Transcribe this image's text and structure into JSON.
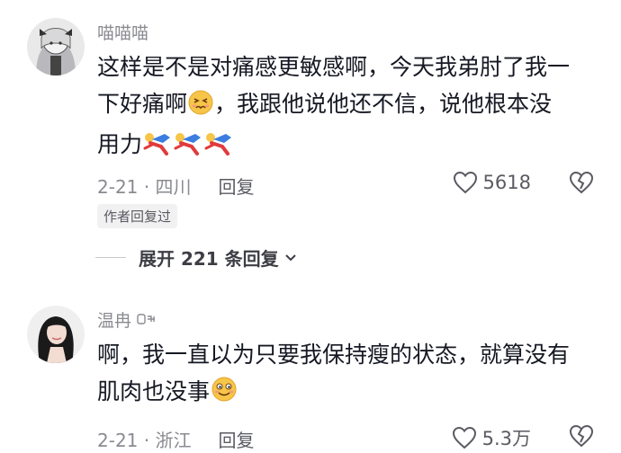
{
  "comments": [
    {
      "username": "喵喵喵",
      "lines": [
        "这样是不是对痛感更敏感啊，今天我弟肘了我一",
        "下好痛啊",
        "，我跟他说他还不信，说他根本没",
        "用力"
      ],
      "emoji_after_line2": "persevering-face",
      "trailing_emoji": [
        "kick-sticker",
        "kick-sticker",
        "kick-sticker"
      ],
      "date_location": "2-21 · 四川",
      "reply_label": "回复",
      "like_count": "5618",
      "author_tag": "作者回复过",
      "expand_label": "展开 221 条回复"
    },
    {
      "username": "温冉",
      "lines": [
        "啊，我一直以为只要我保持瘦的状态，就算没有",
        "肌肉也没事"
      ],
      "trailing_emoji": [
        "slightly-smiling-face"
      ],
      "date_location": "2-21 · 浙江",
      "reply_label": "回复",
      "like_count": "5.3万"
    }
  ],
  "colors": {
    "text_primary": "#161823",
    "text_secondary": "#8a8b91",
    "tag_bg": "#f1f1f2"
  }
}
